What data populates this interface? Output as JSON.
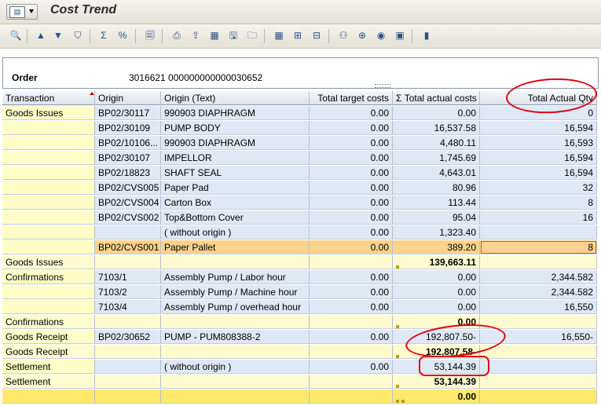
{
  "window": {
    "title": "Cost Trend"
  },
  "header": {
    "order_label": "Order",
    "order_value": "3016621 000000000000030652"
  },
  "grid": {
    "columns": [
      "Transaction",
      "Origin",
      "Origin (Text)",
      "Total target costs",
      "Σ Total actual costs",
      "Total Actual Qty"
    ],
    "rows": [
      {
        "style": "item",
        "transaction": "Goods Issues",
        "origin": "BP02/30117",
        "origin_text": "990903 DIAPHRAGM",
        "target": "0.00",
        "actual": "0.00",
        "qty": "0"
      },
      {
        "style": "item",
        "transaction": "",
        "origin": "BP02/30109",
        "origin_text": "PUMP BODY",
        "target": "0.00",
        "actual": "16,537.58",
        "qty": "16,594"
      },
      {
        "style": "item",
        "transaction": "",
        "origin": "BP02/10106...",
        "origin_text": "990903 DIAPHRAGM",
        "target": "0.00",
        "actual": "4,480.11",
        "qty": "16,593"
      },
      {
        "style": "item",
        "transaction": "",
        "origin": "BP02/30107",
        "origin_text": "IMPELLOR",
        "target": "0.00",
        "actual": "1,745.69",
        "qty": "16,594"
      },
      {
        "style": "item",
        "transaction": "",
        "origin": "BP02/18823",
        "origin_text": "SHAFT SEAL",
        "target": "0.00",
        "actual": "4,643.01",
        "qty": "16,594"
      },
      {
        "style": "item",
        "transaction": "",
        "origin": "BP02/CVS005",
        "origin_text": "Paper Pad",
        "target": "0.00",
        "actual": "80.96",
        "qty": "32"
      },
      {
        "style": "item",
        "transaction": "",
        "origin": "BP02/CVS004",
        "origin_text": "Carton Box",
        "target": "0.00",
        "actual": "113.44",
        "qty": "8"
      },
      {
        "style": "item",
        "transaction": "",
        "origin": "BP02/CVS002",
        "origin_text": "Top&Bottom Cover",
        "target": "0.00",
        "actual": "95.04",
        "qty": "16"
      },
      {
        "style": "item",
        "transaction": "",
        "origin": "",
        "origin_text": "( without origin )",
        "target": "0.00",
        "actual": "1,323.40",
        "qty": ""
      },
      {
        "style": "selected",
        "transaction": "",
        "origin": "BP02/CVS001",
        "origin_text": "Paper Pallet",
        "target": "0.00",
        "actual": "389.20",
        "qty": "8"
      },
      {
        "style": "subtotal",
        "transaction": "Goods Issues",
        "origin": "",
        "origin_text": "",
        "target": "",
        "actual": "139,663.11",
        "qty": ""
      },
      {
        "style": "item",
        "transaction": "Confirmations",
        "origin": "7103/1",
        "origin_text": "Assembly Pump / Labor hour",
        "target": "0.00",
        "actual": "0.00",
        "qty": "2,344.582"
      },
      {
        "style": "item",
        "transaction": "",
        "origin": "7103/2",
        "origin_text": "Assembly Pump / Machine hour",
        "target": "0.00",
        "actual": "0.00",
        "qty": "2,344.582"
      },
      {
        "style": "item",
        "transaction": "",
        "origin": "7103/4",
        "origin_text": "Assembly Pump / overhead hour",
        "target": "0.00",
        "actual": "0.00",
        "qty": "16,550"
      },
      {
        "style": "subtotal",
        "transaction": "Confirmations",
        "origin": "",
        "origin_text": "",
        "target": "",
        "actual": "0.00",
        "qty": ""
      },
      {
        "style": "item",
        "transaction": "Goods Receipt",
        "origin": "BP02/30652",
        "origin_text": "PUMP - PUM808388-2",
        "target": "0.00",
        "actual": "192,807.50-",
        "qty": "16,550-"
      },
      {
        "style": "subtotal",
        "transaction": "Goods Receipt",
        "origin": "",
        "origin_text": "",
        "target": "",
        "actual": "192,807.58-",
        "qty": ""
      },
      {
        "style": "item",
        "transaction": "Settlement",
        "origin": "",
        "origin_text": "( without origin )",
        "target": "0.00",
        "actual": "53,144.39",
        "qty": ""
      },
      {
        "style": "subtotal",
        "transaction": "Settlement",
        "origin": "",
        "origin_text": "",
        "target": "",
        "actual": "53,144.39",
        "qty": ""
      },
      {
        "style": "grandtotal",
        "transaction": "",
        "origin": "",
        "origin_text": "",
        "target": "",
        "actual": "0.00",
        "qty": ""
      }
    ]
  },
  "colors": {
    "annotation": "#e00010",
    "selected_row": "#fbd38f",
    "subtotal_row": "#fffbd0",
    "grand_total_row": "#ffe96b"
  }
}
